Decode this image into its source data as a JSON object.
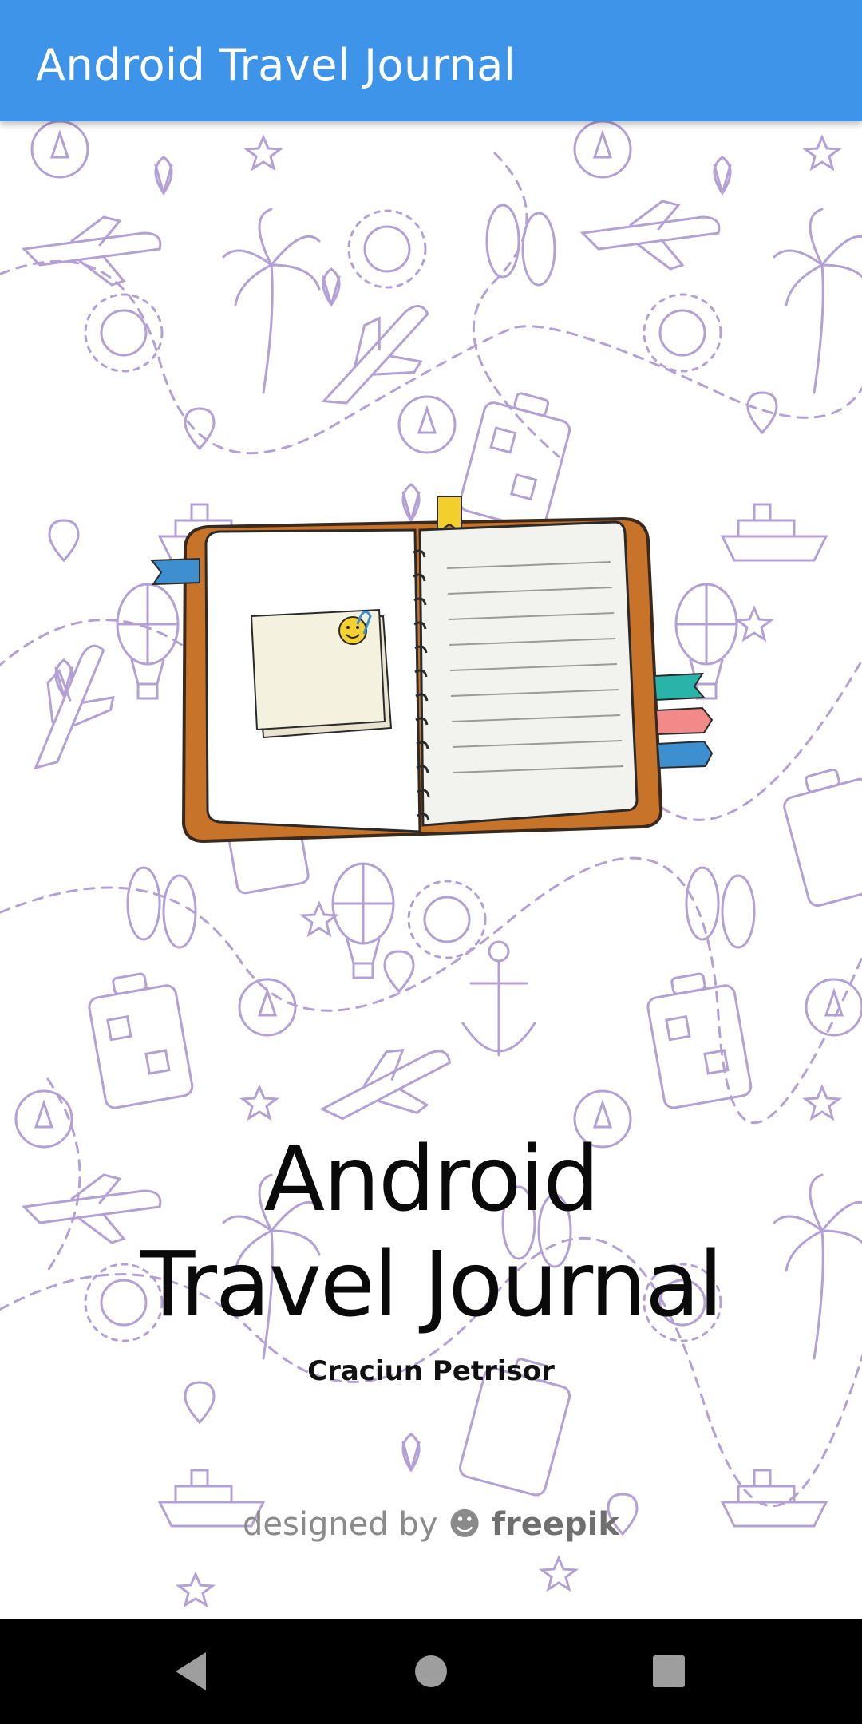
{
  "app_bar": {
    "title": "Android Travel Journal"
  },
  "splash": {
    "title": "Android Travel Journal",
    "author": "Craciun Petrisor",
    "credit_prefix": "designed by",
    "credit_brand": "freepik"
  },
  "colors": {
    "app_bar": "#3d94e8",
    "doodle_stroke": "#b3a0d4",
    "journal_cover": "#c8732a",
    "nav_bar": "#000000"
  },
  "navigation": {
    "back_icon": "back-triangle-icon",
    "home_icon": "home-circle-icon",
    "recents_icon": "recents-square-icon"
  }
}
